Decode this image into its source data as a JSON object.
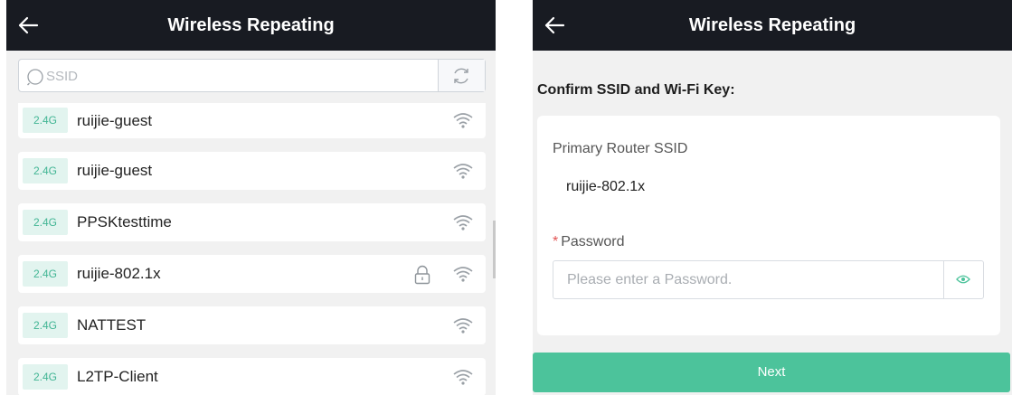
{
  "left_screen": {
    "title": "Wireless Repeating",
    "search": {
      "placeholder": "SSID",
      "value": ""
    },
    "networks": [
      {
        "band": "2.4G",
        "ssid": "ruijie-guest",
        "locked": false
      },
      {
        "band": "2.4G",
        "ssid": "ruijie-guest",
        "locked": false
      },
      {
        "band": "2.4G",
        "ssid": "PPSKtesttime",
        "locked": false
      },
      {
        "band": "2.4G",
        "ssid": "ruijie-802.1x",
        "locked": true
      },
      {
        "band": "2.4G",
        "ssid": "NATTEST",
        "locked": false
      },
      {
        "band": "2.4G",
        "ssid": "L2TP-Client",
        "locked": false
      }
    ]
  },
  "right_screen": {
    "title": "Wireless Repeating",
    "section_title": "Confirm SSID and Wi-Fi Key:",
    "primary_ssid_label": "Primary Router SSID",
    "primary_ssid_value": "ruijie-802.1x",
    "password_required_mark": "*",
    "password_label": "Password",
    "password_placeholder": "Please enter a Password.",
    "password_value": "",
    "next_label": "Next"
  },
  "icons": {
    "back": "back-arrow-icon",
    "search": "search-icon",
    "refresh": "refresh-icon",
    "lock": "lock-icon",
    "wifi": "wifi-icon",
    "eye": "eye-icon"
  },
  "colors": {
    "header_bg": "#181b22",
    "accent": "#4cc39b",
    "band_bg": "#e2f4ef",
    "band_text": "#41b594",
    "required": "#e25454",
    "panel_bg": "#f1f1f1"
  }
}
